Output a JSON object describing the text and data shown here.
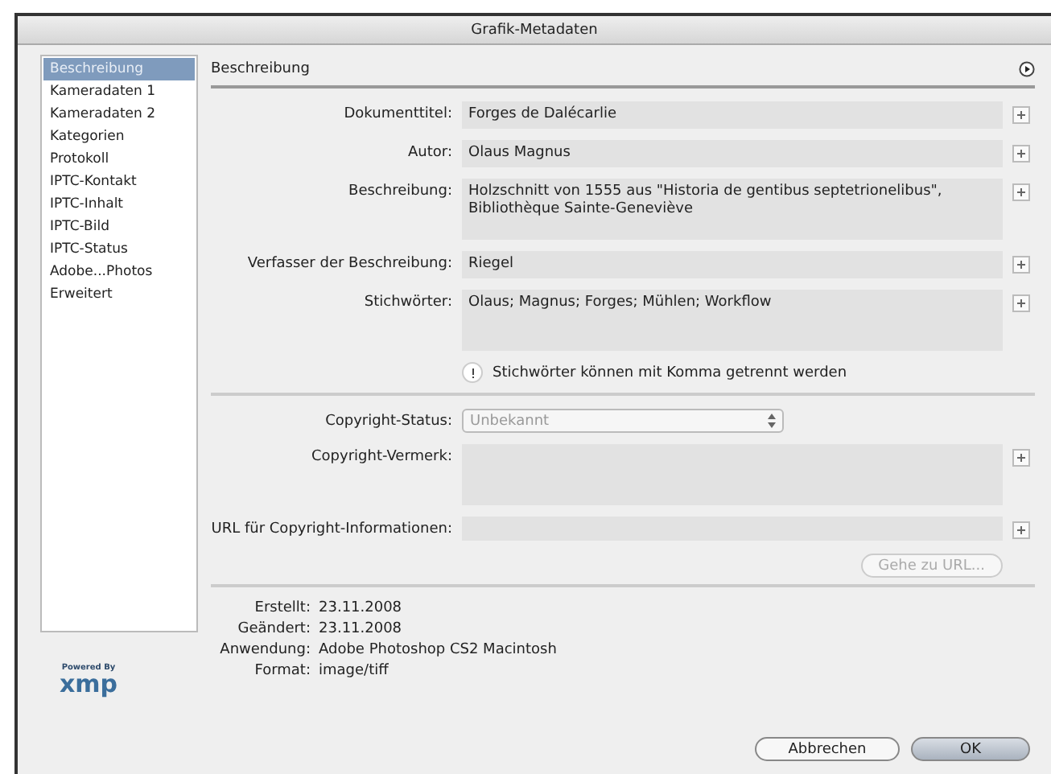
{
  "window": {
    "title": "Grafik-Metadaten"
  },
  "sidebar": {
    "items": [
      {
        "label": "Beschreibung",
        "selected": true
      },
      {
        "label": "Kameradaten 1",
        "selected": false
      },
      {
        "label": "Kameradaten 2",
        "selected": false
      },
      {
        "label": "Kategorien",
        "selected": false
      },
      {
        "label": "Protokoll",
        "selected": false
      },
      {
        "label": "IPTC-Kontakt",
        "selected": false
      },
      {
        "label": "IPTC-Inhalt",
        "selected": false
      },
      {
        "label": "IPTC-Bild",
        "selected": false
      },
      {
        "label": "IPTC-Status",
        "selected": false
      },
      {
        "label": "Adobe...Photos",
        "selected": false
      },
      {
        "label": "Erweitert",
        "selected": false
      }
    ]
  },
  "panel": {
    "title": "Beschreibung"
  },
  "fields": [
    {
      "kind": "text",
      "label": "Dokumenttitel:",
      "value": "Forges de Dalécarlie"
    },
    {
      "kind": "text",
      "label": "Autor:",
      "value": "Olaus Magnus"
    },
    {
      "kind": "textarea",
      "label": "Beschreibung:",
      "value": "Holzschnitt von 1555 aus \"Historia de gentibus septetrionelibus\", Bibliothèque Sainte-Geneviève"
    },
    {
      "kind": "text",
      "label": "Verfasser der Beschreibung:",
      "value": "Riegel"
    },
    {
      "kind": "textarea",
      "label": "Stichwörter:",
      "value": "Olaus; Magnus; Forges; Mühlen; Workflow"
    }
  ],
  "hint": "Stichwörter können mit Komma getrennt werden",
  "copyright_fields": [
    {
      "kind": "select",
      "label": "Copyright-Status:",
      "value": "Unbekannt"
    },
    {
      "kind": "textarea",
      "label": "Copyright-Vermerk:"
    },
    {
      "kind": "text",
      "label": "URL für Copyright-Informationen:"
    }
  ],
  "url_button": {
    "label": "Gehe zu URL...",
    "disabled": true
  },
  "info": [
    {
      "label": "Erstellt:",
      "value": "23.11.2008"
    },
    {
      "label": "Geändert:",
      "value": "23.11.2008"
    },
    {
      "label": "Anwendung:",
      "value": "Adobe Photoshop CS2 Macintosh"
    },
    {
      "label": "Format:",
      "value": "image/tiff"
    }
  ],
  "logo": {
    "caption": "Powered By",
    "mark": "xmp"
  },
  "buttons": [
    {
      "label": "Abbrechen",
      "default": false
    },
    {
      "label": "OK",
      "default": true
    }
  ]
}
